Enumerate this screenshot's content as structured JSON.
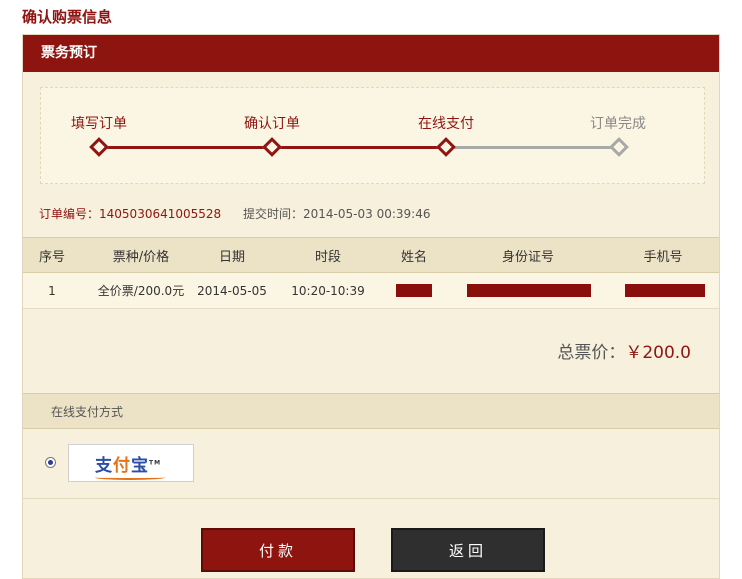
{
  "page_title": "确认购票信息",
  "panel": {
    "title": "票务预订"
  },
  "steps": [
    {
      "label": "填写订单",
      "state": "done"
    },
    {
      "label": "确认订单",
      "state": "done"
    },
    {
      "label": "在线支付",
      "state": "current"
    },
    {
      "label": "订单完成",
      "state": "todo"
    }
  ],
  "order": {
    "number_label": "订单编号：",
    "number": "1405030641005528",
    "time_label": "提交时间：",
    "time": "2014-05-03 00:39:46"
  },
  "table": {
    "headers": [
      "序号",
      "票种/价格",
      "日期",
      "时段",
      "姓名",
      "身份证号",
      "手机号"
    ],
    "rows": [
      {
        "index": "1",
        "ticket": "全价票/200.0元",
        "date": "2014-05-05",
        "slot": "10:20-10:39"
      }
    ]
  },
  "total": {
    "label": "总票价：",
    "amount": "￥200.0"
  },
  "payment": {
    "section_label": "在线支付方式",
    "method": "支付宝",
    "selected": true
  },
  "buttons": {
    "pay": "付款",
    "back": "返回"
  },
  "colors": {
    "accent": "#8e140f",
    "panel_bg": "#f7f0dc",
    "muted": "#a8a8a8"
  }
}
